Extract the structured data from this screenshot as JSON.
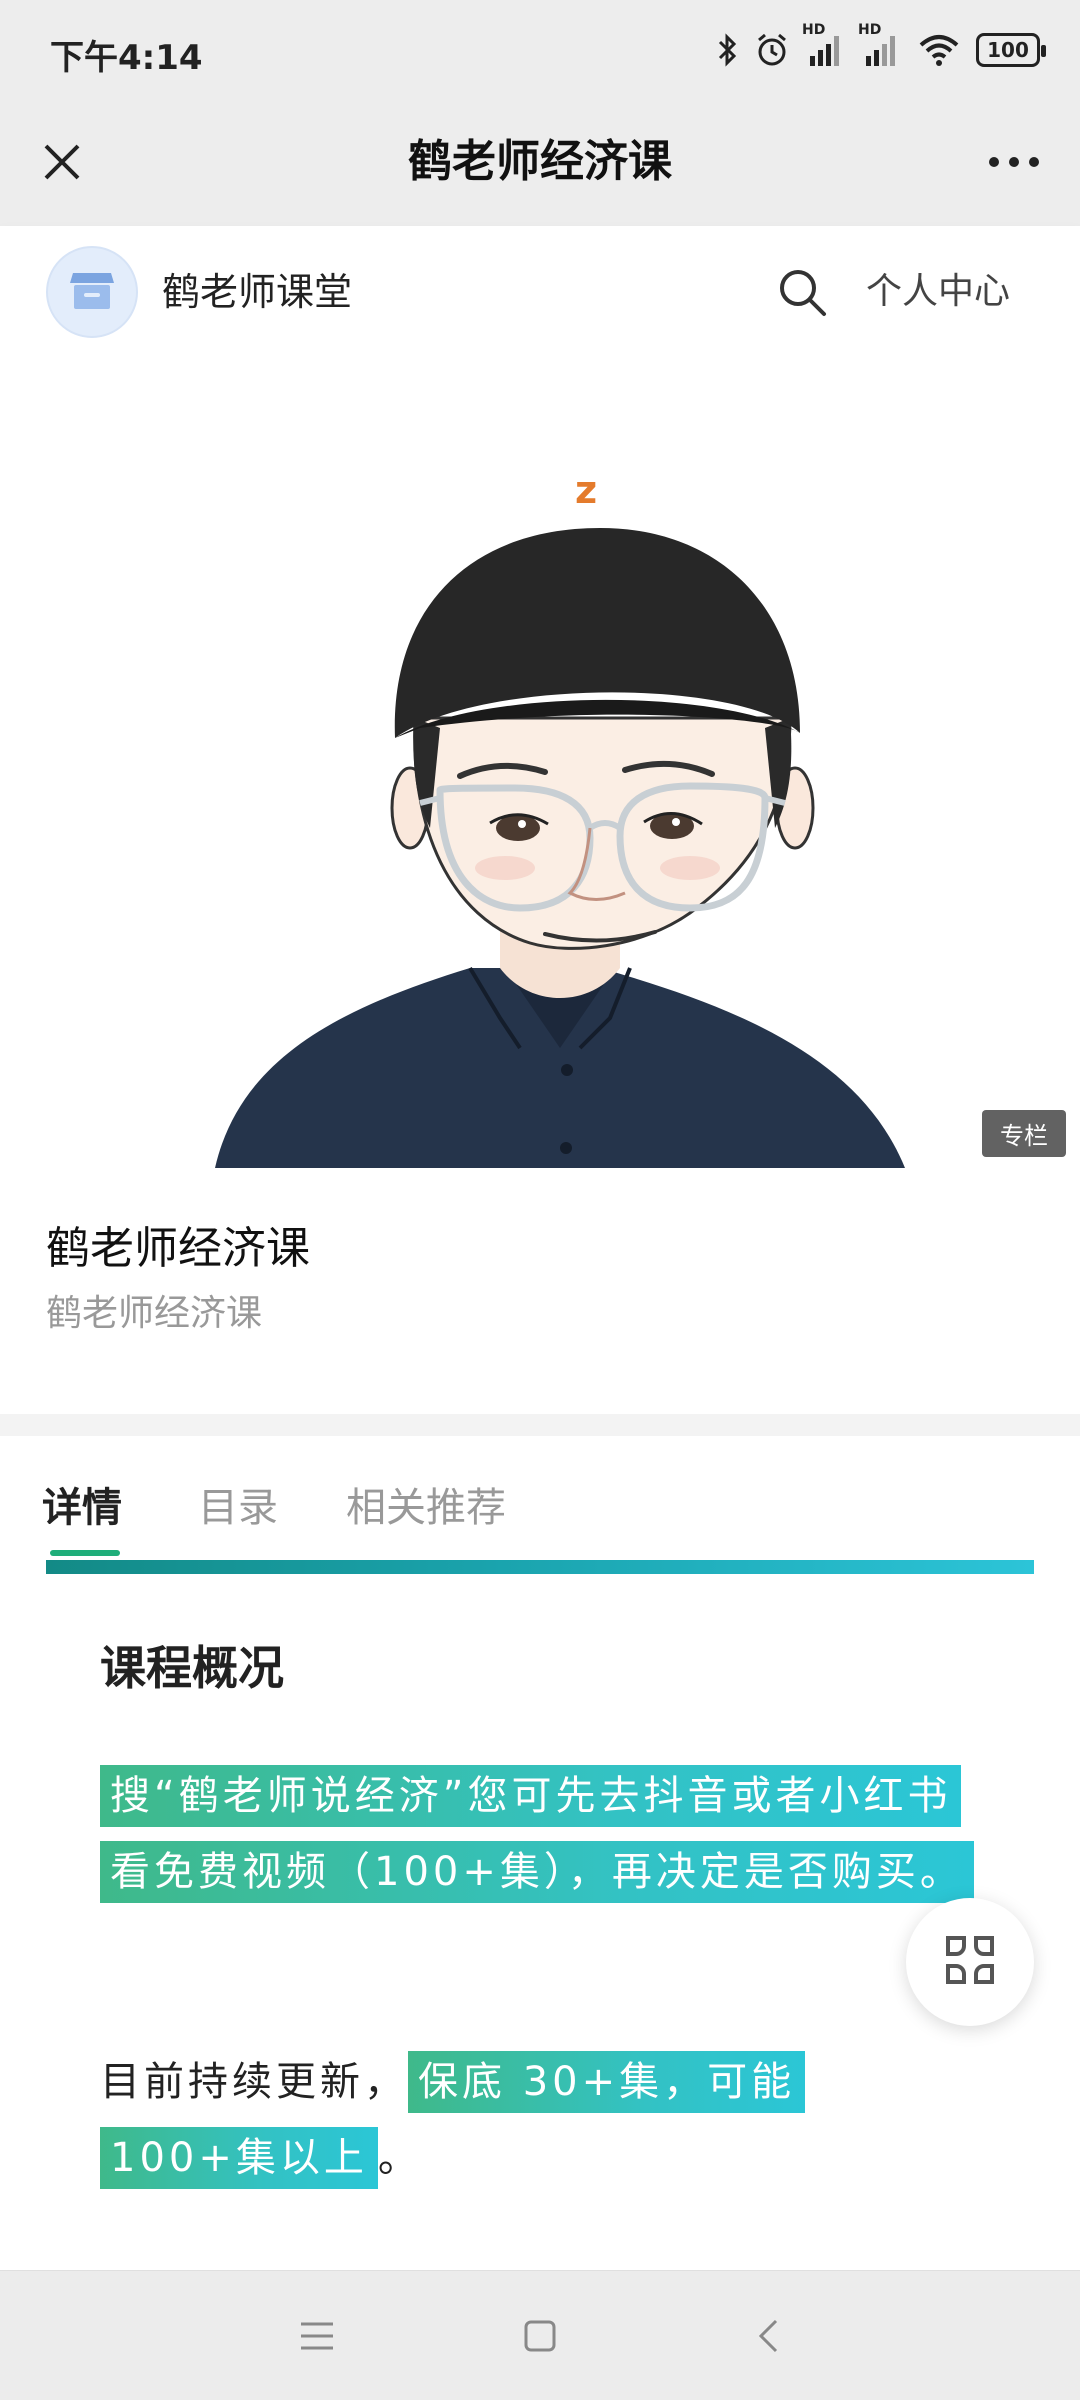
{
  "status_bar": {
    "time": "下午4:14",
    "hd_label_1": "HD",
    "hd_label_2": "HD",
    "battery": "100"
  },
  "nav": {
    "title": "鹤老师经济课",
    "close_icon": "close-icon",
    "more_icon": "more-icon"
  },
  "shop": {
    "name": "鹤老师课堂",
    "personal_center": "个人中心",
    "avatar_icon": "store-icon",
    "search_icon": "search-icon"
  },
  "cover": {
    "badge": "专栏",
    "cap_letter": "z"
  },
  "course": {
    "title": "鹤老师经济课",
    "subtitle": "鹤老师经济课"
  },
  "tabs": [
    {
      "label": "详情",
      "active": true
    },
    {
      "label": "目录",
      "active": false
    },
    {
      "label": "相关推荐",
      "active": false
    }
  ],
  "content": {
    "heading": "课程概况",
    "para1_highlight": "搜“鹤老师说经济”您可先去抖音或者小红书看免费视频（100+集），再决定是否购买。",
    "para2_plain": "目前持续更新，",
    "para2_highlight": "保底 30+集，可能 100+集以上",
    "para2_end": "。"
  },
  "colors": {
    "accent_green": "#1fae7a",
    "accent_teal": "#2cc4d8",
    "nav_bg": "#ededed"
  },
  "floating_button": {
    "icon": "grid-icon"
  },
  "system_nav": {
    "menu_icon": "menu-icon",
    "home_icon": "home-icon",
    "back_icon": "back-icon"
  }
}
